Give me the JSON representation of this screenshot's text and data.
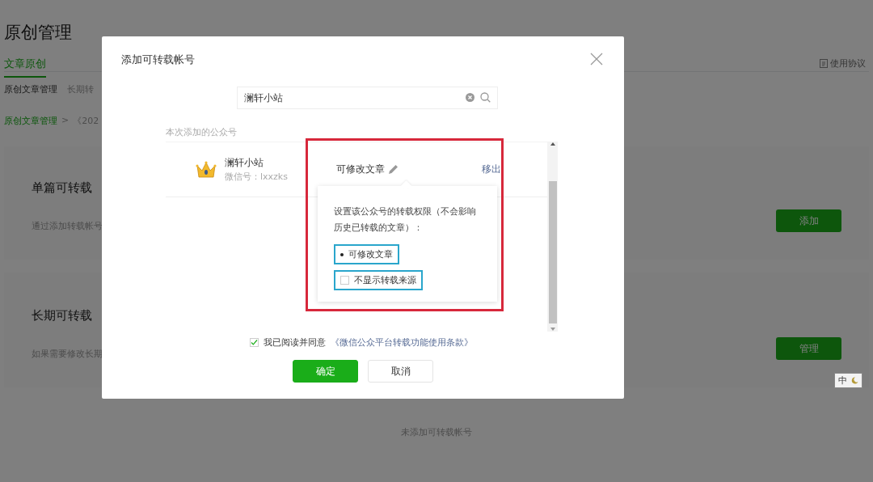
{
  "page": {
    "title": "原创管理",
    "tabs": [
      {
        "label": "文章原创",
        "selected": true
      }
    ],
    "help_link": "使用协议",
    "subnav": [
      {
        "label": "原创文章管理",
        "selected": true
      },
      {
        "label": "长期转",
        "selected": false
      }
    ],
    "breadcrumb": [
      "原创文章管理",
      ">",
      "《202"
    ],
    "sections": [
      {
        "heading": "单篇可转载",
        "description": "通过添加转载帐号",
        "button": "添加"
      },
      {
        "heading": "长期可转载",
        "description": "如果需要修改长期",
        "button": "管理"
      }
    ],
    "empty_text": "未添加可转载帐号"
  },
  "ime": {
    "label": "中"
  },
  "dialog": {
    "title": "添加可转载帐号",
    "search": {
      "value": "澜轩小站"
    },
    "section_label": "本次添加的公众号",
    "accounts": [
      {
        "name": "澜轩小站",
        "wechat_id": "微信号：lxxzks",
        "permission": "可修改文章",
        "remove": "移出"
      }
    ],
    "popover": {
      "highlighted": true,
      "description": "设置该公众号的转载权限（不会影响历史已转载的文章）：",
      "options": [
        {
          "kind": "radio",
          "label": "可修改文章",
          "selected": true,
          "highlighted": true
        },
        {
          "kind": "checkbox",
          "label": "不显示转载来源",
          "checked": false,
          "highlighted": true
        }
      ]
    },
    "agreement": {
      "checked": true,
      "text": "我已阅读并同意",
      "link": "《微信公众平台转载功能使用条款》"
    },
    "buttons": [
      {
        "kind": "primary",
        "label": "确定"
      },
      {
        "kind": "default",
        "label": "取消"
      }
    ]
  }
}
